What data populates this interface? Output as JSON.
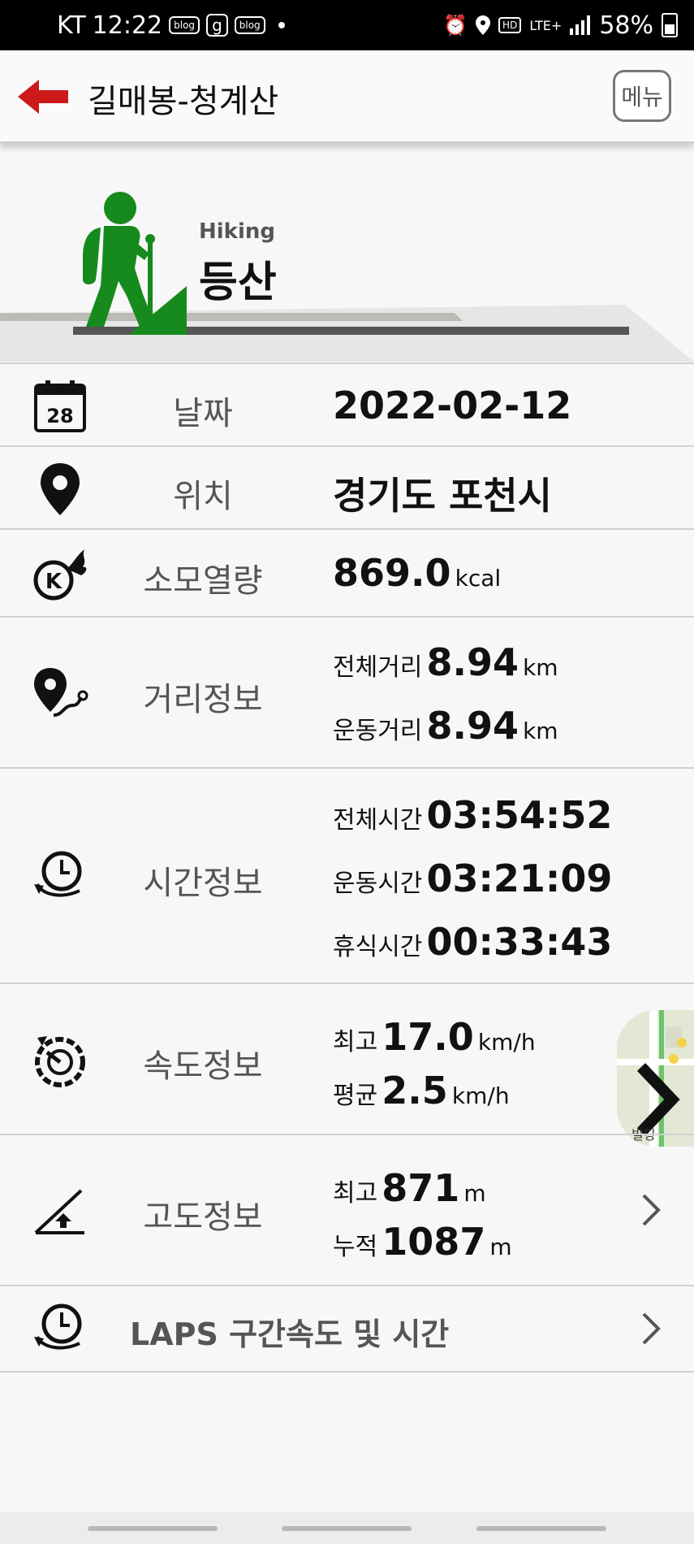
{
  "status_bar": {
    "carrier": "KT",
    "time": "12:22",
    "chip1": "blog",
    "chip2": "g",
    "chip3": "blog",
    "hd": "HD",
    "network": "LTE+",
    "battery": "58%",
    "icons": [
      "alarm-icon",
      "location-icon",
      "signal-icon",
      "battery-icon"
    ]
  },
  "header": {
    "title": "길매봉-청계산",
    "menu_label": "메뉴",
    "back_icon": "back-arrow-icon",
    "accent_color": "#cc1a1a"
  },
  "hero": {
    "subtitle": "Hiking",
    "title": "등산",
    "icon": "hiker-icon",
    "icon_color": "#178a1d"
  },
  "rows": {
    "date": {
      "label": "날짜",
      "value": "2022-02-12",
      "icon": "calendar-icon",
      "icon_text": "28"
    },
    "location": {
      "label": "위치",
      "value": "경기도 포천시",
      "icon": "location-pin-icon"
    },
    "calories": {
      "label": "소모열량",
      "value": "869.0",
      "unit": "kcal",
      "icon": "calorie-icon"
    },
    "distance": {
      "label": "거리정보",
      "icon": "distance-icon",
      "total_label": "전체거리",
      "total_value": "8.94",
      "total_unit": "km",
      "moving_label": "운동거리",
      "moving_value": "8.94",
      "moving_unit": "km"
    },
    "time": {
      "label": "시간정보",
      "icon": "time-icon",
      "total_label": "전체시간",
      "total_value": "03:54:52",
      "moving_label": "운동시간",
      "moving_value": "03:21:09",
      "rest_label": "휴식시간",
      "rest_value": "00:33:43"
    },
    "speed": {
      "label": "속도정보",
      "icon": "speedometer-icon",
      "max_label": "최고",
      "max_value": "17.0",
      "max_unit": "km/h",
      "avg_label": "평균",
      "avg_value": "2.5",
      "avg_unit": "km/h"
    },
    "altitude": {
      "label": "고도정보",
      "icon": "altitude-icon",
      "max_label": "최고",
      "max_value": "871",
      "max_unit": "m",
      "cum_label": "누적",
      "cum_value": "1087",
      "cum_unit": "m"
    },
    "laps": {
      "label": "LAPS 구간속도 및 시간",
      "icon": "laps-icon"
    }
  },
  "map_preview": {
    "icon": "map-thumbnail-icon",
    "arrow_icon": "chevron-right-icon",
    "caption": "빌딩"
  }
}
